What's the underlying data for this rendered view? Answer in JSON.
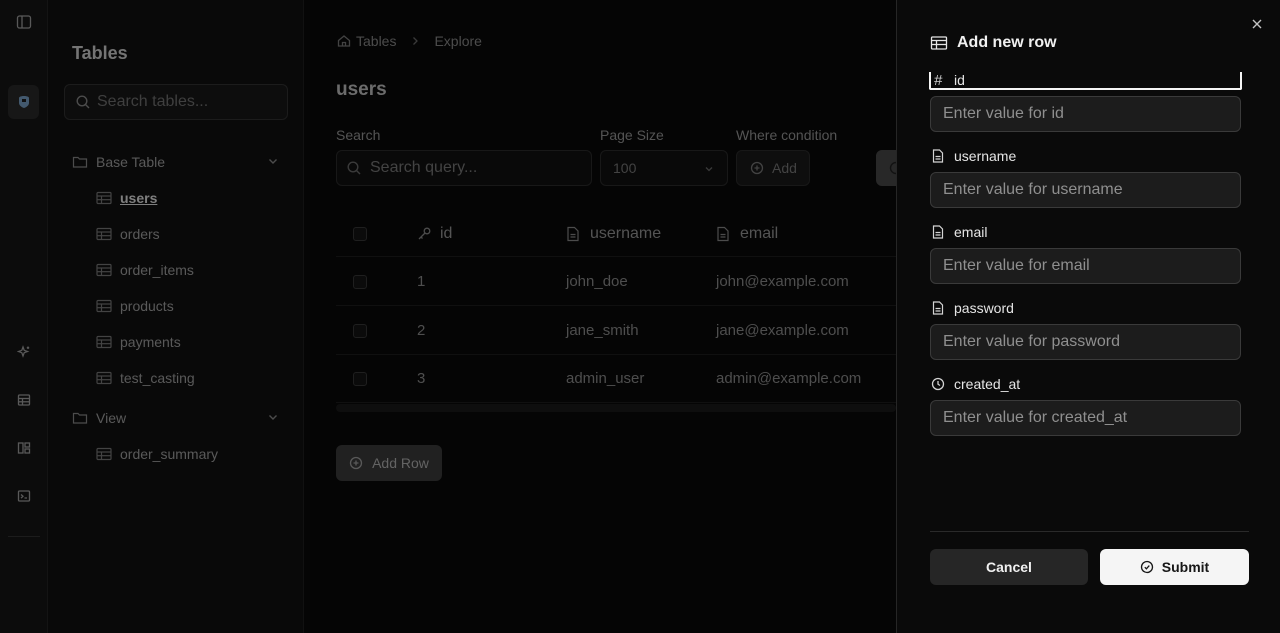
{
  "rail": {
    "icons": [
      "sidebar-toggle-icon",
      "database-icon",
      "sparkles-icon",
      "table-icon",
      "layout-icon",
      "terminal-icon"
    ]
  },
  "sidebar": {
    "title": "Tables",
    "search_placeholder": "Search tables...",
    "groups": [
      {
        "label": "Base Table",
        "items": [
          "users",
          "orders",
          "order_items",
          "products",
          "payments",
          "test_casting"
        ]
      },
      {
        "label": "View",
        "items": [
          "order_summary"
        ]
      }
    ],
    "active_item": "users"
  },
  "main": {
    "breadcrumb": [
      "Tables",
      "Explore"
    ],
    "title": "users",
    "search_label": "Search",
    "search_placeholder": "Search query...",
    "page_size_label": "Page Size",
    "page_size_value": "100",
    "where_label": "Where condition",
    "where_add": "Add",
    "columns": [
      "id",
      "username",
      "email"
    ],
    "rows": [
      [
        "1",
        "john_doe",
        "john@example.com"
      ],
      [
        "2",
        "jane_smith",
        "jane@example.com"
      ],
      [
        "3",
        "admin_user",
        "admin@example.com"
      ]
    ],
    "add_row_label": "Add Row"
  },
  "panel": {
    "title": "Add new row",
    "fields": [
      {
        "label": "id",
        "icon": "hash-icon",
        "placeholder": "Enter value for id"
      },
      {
        "label": "username",
        "icon": "file-text-icon",
        "placeholder": "Enter value for username"
      },
      {
        "label": "email",
        "icon": "file-text-icon",
        "placeholder": "Enter value for email"
      },
      {
        "label": "password",
        "icon": "file-text-icon",
        "placeholder": "Enter value for password"
      },
      {
        "label": "created_at",
        "icon": "clock-icon",
        "placeholder": "Enter value for created_at"
      }
    ],
    "cancel_label": "Cancel",
    "submit_label": "Submit"
  }
}
